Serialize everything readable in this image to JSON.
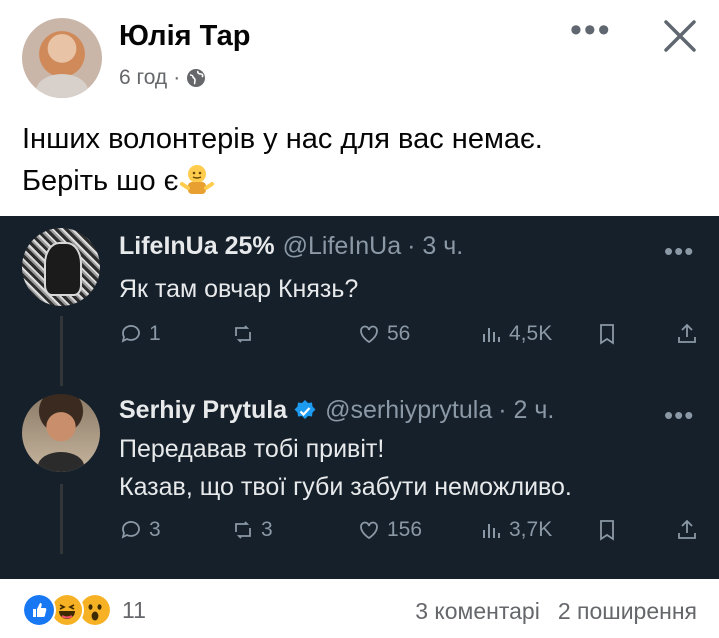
{
  "post": {
    "author": "Юлія Тар",
    "time": "6 год",
    "separator": "·",
    "more_icon": "more-dots-icon",
    "close_icon": "close-icon",
    "privacy_icon": "globe-icon",
    "text_line1": "Інших волонтерів у нас для вас немає.",
    "text_line2": "Беріть шо є"
  },
  "tweets": [
    {
      "name": "LifeInUa 25%",
      "handle": "@LifeInUa",
      "time": "· 3 ч.",
      "text": [
        "Як там овчар Князь?"
      ],
      "replies": "1",
      "retweets": "",
      "likes": "56",
      "views": "4,5K"
    },
    {
      "name": "Serhiy Prytula",
      "handle": "@serhiyprytula",
      "time": "· 2 ч.",
      "verified": true,
      "text": [
        "Передавав тобі привіт!",
        "Казав, що твої губи забути неможливо."
      ],
      "replies": "3",
      "retweets": "3",
      "likes": "156",
      "views": "3,7K"
    }
  ],
  "footer": {
    "reaction_count": "11",
    "comments": "3 коментарі",
    "shares": "2 поширення"
  },
  "colors": {
    "tweet_bg": "#15202b",
    "tweet_text": "#e7e9ea",
    "tweet_muted": "#8b98a5",
    "like_blue": "#1877f2",
    "verified_blue": "#1d9bf0"
  }
}
